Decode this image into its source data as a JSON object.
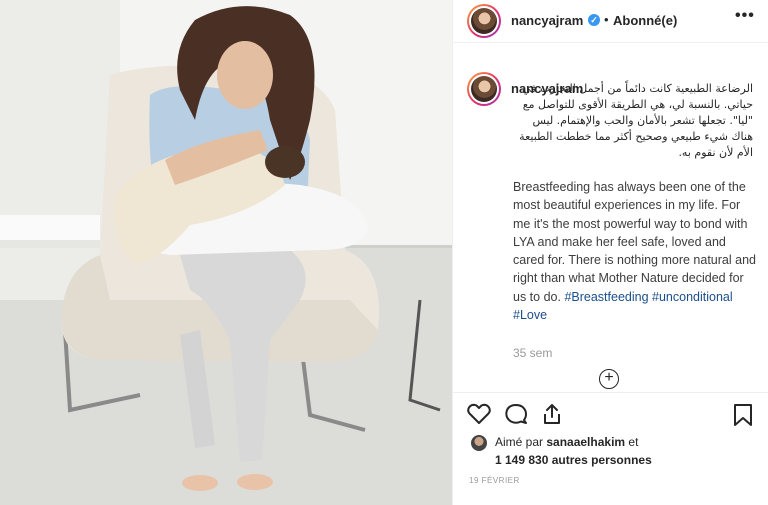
{
  "post": {
    "username": "nancyajram",
    "verified_mark": "✓",
    "dot": "•",
    "follow_status": "Abonné(e)",
    "more_icon": "•••",
    "caption_arabic": "الرضاعة الطبيعية كانت دائماً من أجمل التجارب في حياتي. بالنسبة لي، هي الطريقة الأقوى للتواصل مع \"ليا\". تجعلها تشعر بالأمان والحب والإهتمام. ليس هناك شيء طبيعي وصحيح أكثر مما خططت الطبيعة الأم لأن نقوم به.",
    "caption_english": "Breastfeeding has always been one of the most beautiful experiences in my life. For me it's the most powerful way to bond with LYA and make her feel safe, loved and cared for. There is nothing more natural and right than what Mother Nature decided for us to do. ",
    "hashtags": [
      "#Breastfeeding",
      "#unconditional",
      "#Love"
    ],
    "time_ago": "35 sem",
    "load_more_icon": "+",
    "liked_by_prefix": "Aimé par ",
    "liked_by_user": "sanaaelhakim",
    "liked_by_suffix": " et",
    "like_count": "1 149 830 autres personnes",
    "date": "19 FÉVRIER"
  },
  "icons": {
    "like": "heart-icon",
    "comment": "comment-icon",
    "share": "share-icon",
    "save": "bookmark-icon"
  },
  "colors": {
    "verified": "#3897f0",
    "hashtag": "#1b4f8c",
    "muted": "#999999"
  }
}
